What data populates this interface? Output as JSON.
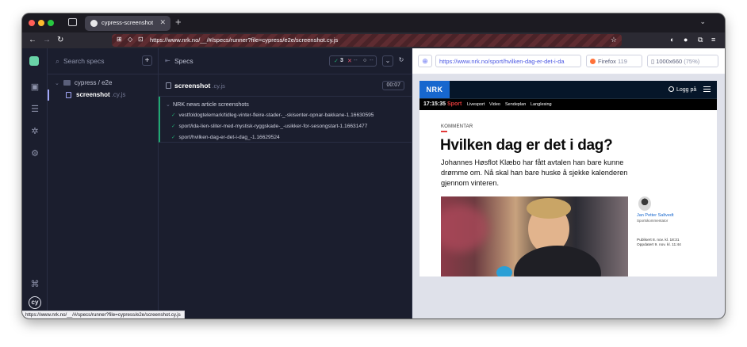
{
  "browser": {
    "tab_title": "cypress-screenshot",
    "url": "https://www.nrk.no/__/#/specs/runner?file=cypress/e2e/screenshot.cy.js",
    "status_url": "https://www.nrk.no/__/#/specs/runner?file=cypress/e2e/screenshot.cy.js"
  },
  "sidebar": {
    "search_placeholder": "Search specs",
    "folder": "cypress / e2e",
    "file_name": "screenshot",
    "file_ext": ".cy.js"
  },
  "reporter": {
    "specs_label": "Specs",
    "stats": {
      "passed": "3",
      "failed": "--",
      "pending": "--"
    },
    "spec_name": "screenshot",
    "spec_ext": ".cy.js",
    "duration": "00:07",
    "suite_title": "NRK news article screenshots",
    "tests": [
      "vestfoldogtelemark/tidleg-vinter-fleire-stader-_-skisenter-opnar-bakkane-1.16630595",
      "sport/ida-lien-sliter-med-mystisk-ryggskade-_-usikker-for-sesongstart-1.16631477",
      "sport/hvilken-dag-er-det-i-dag_-1.16629524"
    ]
  },
  "aut": {
    "url": "https://www.nrk.no/sport/hvilken-dag-er-det-i-da",
    "browser_name": "Firefox",
    "browser_version": "119",
    "viewport": "1000x660",
    "zoom": "(75%)"
  },
  "article": {
    "logo": "NRK",
    "login": "Logg på",
    "time": "17:15:35",
    "section": "Sport",
    "subnav": [
      "Livesport",
      "Video",
      "Sendeplan",
      "Langlesing"
    ],
    "kicker": "KOMMENTAR",
    "headline": "Hvilken dag er det i dag?",
    "lead": "Johannes Høsflot Klæbo har fått avtalen han bare kunne drømme om. Nå skal han bare huske å sjekke kalenderen gjennom vinteren.",
    "author_name": "Jan Petter Saltvedt",
    "author_role": "Sportskommentator",
    "published": "Publisert 8. nov. kl. 18:31",
    "updated": "Oppdatert 9. nov. kl. 11:44"
  },
  "colors": {
    "cypress_bg": "#1b1e2e",
    "pass_green": "#1fa971",
    "fail_red": "#e45770",
    "nrk_blue": "#1767ce",
    "nrk_navy": "#061629",
    "url_link": "#4956e3"
  }
}
